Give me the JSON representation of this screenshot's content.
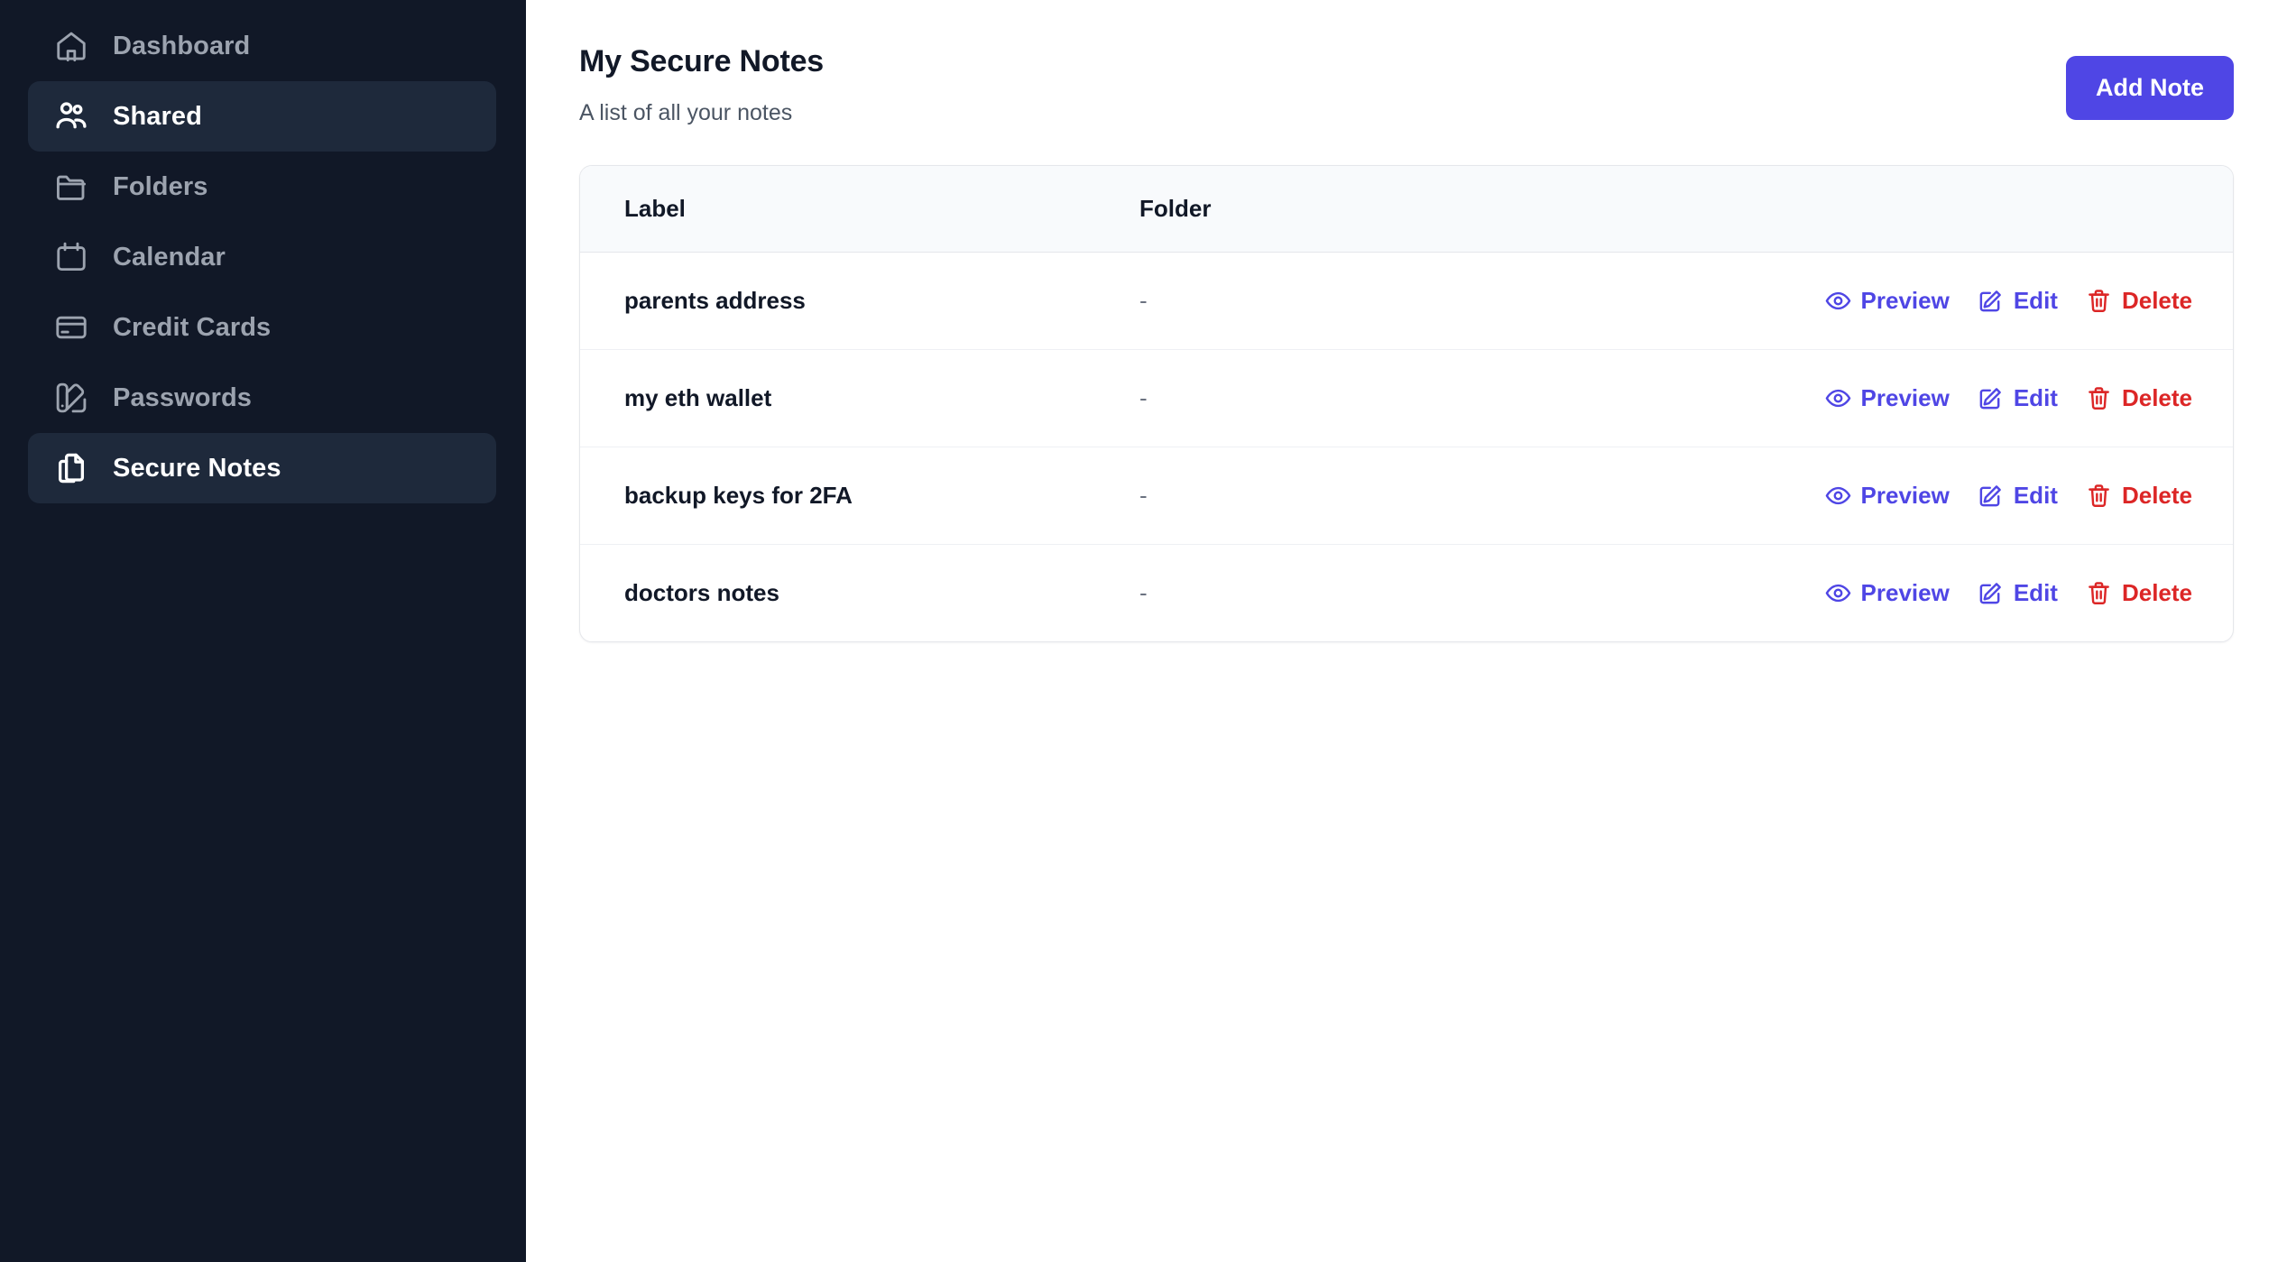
{
  "sidebar": {
    "items": [
      {
        "label": "Dashboard",
        "icon": "home-icon",
        "active": false
      },
      {
        "label": "Shared",
        "icon": "users-icon",
        "active": true
      },
      {
        "label": "Folders",
        "icon": "folder-icon",
        "active": false
      },
      {
        "label": "Calendar",
        "icon": "calendar-icon",
        "active": false
      },
      {
        "label": "Credit Cards",
        "icon": "credit-card-icon",
        "active": false
      },
      {
        "label": "Passwords",
        "icon": "swatch-icon",
        "active": false
      },
      {
        "label": "Secure Notes",
        "icon": "documents-icon",
        "active": true
      }
    ]
  },
  "header": {
    "title": "My Secure Notes",
    "subtitle": "A list of all your notes",
    "add_button_label": "Add Note"
  },
  "table": {
    "columns": [
      "Label",
      "Folder"
    ],
    "rows": [
      {
        "label": "parents address",
        "folder": "-"
      },
      {
        "label": "my eth wallet",
        "folder": "-"
      },
      {
        "label": "backup keys for 2FA",
        "folder": "-"
      },
      {
        "label": "doctors notes",
        "folder": "-"
      }
    ],
    "actions": {
      "preview_label": "Preview",
      "edit_label": "Edit",
      "delete_label": "Delete"
    }
  },
  "colors": {
    "sidebar_bg": "#111827",
    "sidebar_active_bg": "#1e293b",
    "accent": "#4f46e5",
    "danger": "#dc2626",
    "table_header_bg": "#f8fafc"
  }
}
